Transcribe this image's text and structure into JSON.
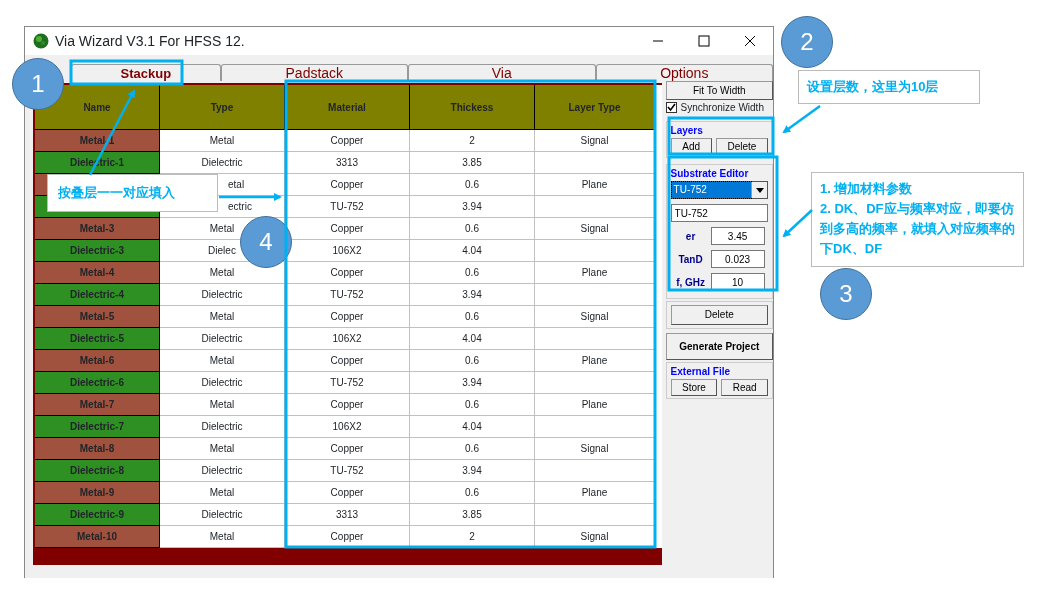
{
  "window": {
    "title": "Via Wizard V3.1 For HFSS 12."
  },
  "tabs": [
    {
      "label": "Stackup",
      "selected": true
    },
    {
      "label": "Padstack",
      "selected": false
    },
    {
      "label": "Via",
      "selected": false
    },
    {
      "label": "Options",
      "selected": false
    }
  ],
  "table": {
    "columns": [
      "Name",
      "Type",
      "Material",
      "Thickess",
      "Layer Type"
    ],
    "rows": [
      {
        "kind": "metal",
        "name": "Metal-1",
        "type": "Metal",
        "material": "Copper",
        "thickness": "2",
        "layer_type": "Signal"
      },
      {
        "kind": "dielectric",
        "name": "Dielectric-1",
        "type": "Dielectric",
        "material": "3313",
        "thickness": "3.85"
      },
      {
        "kind": "metal",
        "type": "etal",
        "material": "Copper",
        "thickness": "0.6",
        "layer_type": "Plane"
      },
      {
        "kind": "dielectric",
        "type": "ectric",
        "material": "TU-752",
        "thickness": "3.94"
      },
      {
        "kind": "metal",
        "name": "Metal-3",
        "type": "Metal",
        "material": "Copper",
        "thickness": "0.6",
        "layer_type": "Signal"
      },
      {
        "kind": "dielectric",
        "name": "Dielectric-3",
        "type": "Dielec",
        "material": "106X2",
        "thickness": "4.04"
      },
      {
        "kind": "metal",
        "name": "Metal-4",
        "type": "Metal",
        "material": "Copper",
        "thickness": "0.6",
        "layer_type": "Plane"
      },
      {
        "kind": "dielectric",
        "name": "Dielectric-4",
        "type": "Dielectric",
        "material": "TU-752",
        "thickness": "3.94"
      },
      {
        "kind": "metal",
        "name": "Metal-5",
        "type": "Metal",
        "material": "Copper",
        "thickness": "0.6",
        "layer_type": "Signal"
      },
      {
        "kind": "dielectric",
        "name": "Dielectric-5",
        "type": "Dielectric",
        "material": "106X2",
        "thickness": "4.04"
      },
      {
        "kind": "metal",
        "name": "Metal-6",
        "type": "Metal",
        "material": "Copper",
        "thickness": "0.6",
        "layer_type": "Plane"
      },
      {
        "kind": "dielectric",
        "name": "Dielectric-6",
        "type": "Dielectric",
        "material": "TU-752",
        "thickness": "3.94"
      },
      {
        "kind": "metal",
        "name": "Metal-7",
        "type": "Metal",
        "material": "Copper",
        "thickness": "0.6",
        "layer_type": "Plane"
      },
      {
        "kind": "dielectric",
        "name": "Dielectric-7",
        "type": "Dielectric",
        "material": "106X2",
        "thickness": "4.04"
      },
      {
        "kind": "metal",
        "name": "Metal-8",
        "type": "Metal",
        "material": "Copper",
        "thickness": "0.6",
        "layer_type": "Signal"
      },
      {
        "kind": "dielectric",
        "name": "Dielectric-8",
        "type": "Dielectric",
        "material": "TU-752",
        "thickness": "3.94"
      },
      {
        "kind": "metal",
        "name": "Metal-9",
        "type": "Metal",
        "material": "Copper",
        "thickness": "0.6",
        "layer_type": "Plane"
      },
      {
        "kind": "dielectric",
        "name": "Dielectric-9",
        "type": "Dielectric",
        "material": "3313",
        "thickness": "3.85"
      },
      {
        "kind": "metal",
        "name": "Metal-10",
        "type": "Metal",
        "material": "Copper",
        "thickness": "2",
        "layer_type": "Signal"
      }
    ]
  },
  "side_panel": {
    "fit_button": "Fit To Width",
    "sync_checkbox": {
      "label": "Synchronize Width",
      "checked": true
    },
    "layers": {
      "title": "Layers",
      "buttons": [
        "Add",
        "Delete"
      ]
    },
    "substrate_editor": {
      "title": "Substrate Editor",
      "material_select": "TU-752",
      "name_field": "TU-752",
      "params": [
        {
          "label": "er",
          "value": "3.45"
        },
        {
          "label": "TanD",
          "value": "0.023"
        },
        {
          "label": "f, GHz",
          "value": "10"
        }
      ],
      "delete_button": "Delete"
    },
    "generate_button": "Generate Project",
    "external_file": {
      "title": "External File",
      "buttons": [
        "Store",
        "Read"
      ]
    }
  },
  "annotations": {
    "markers": [
      "1",
      "2",
      "3",
      "4"
    ],
    "notes": [
      {
        "lines": [
          "设置层数，这里为10层"
        ]
      },
      {
        "lines": [
          "按叠层一一对应填入"
        ]
      },
      {
        "lines": [
          "1. 增加材料参数",
          "2. DK、DF应与频率对应，即要仿到多高的频率，就填入对应频率的下DK、DF"
        ]
      }
    ]
  }
}
